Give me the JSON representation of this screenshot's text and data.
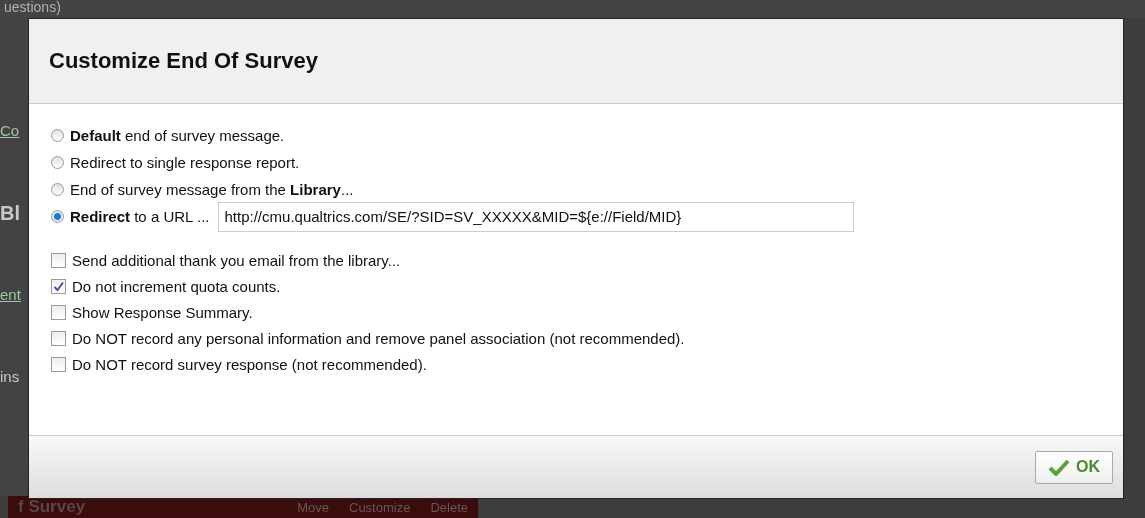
{
  "background": {
    "top_text": "uestions)",
    "side_items": [
      {
        "kind": "link",
        "text": "Co"
      },
      {
        "kind": "heading",
        "text": "Bl"
      },
      {
        "kind": "link",
        "text": "ent"
      },
      {
        "kind": "text",
        "text": "ins"
      }
    ],
    "bottom_bar": {
      "title": "f Survey",
      "actions": [
        "Move",
        "Customize",
        "Delete"
      ]
    }
  },
  "dialog": {
    "title": "Customize End Of Survey",
    "end_options": [
      {
        "label": "**Default** end of survey message.",
        "selected": false
      },
      {
        "label": "Redirect to single response report.",
        "selected": false
      },
      {
        "label": "End of survey message from the **Library**...",
        "selected": false
      },
      {
        "label": "**Redirect** to a URL ...",
        "selected": true,
        "url": "http://cmu.qualtrics.com/SE/?SID=SV_XXXXX&MID=${e://Field/MID}"
      }
    ],
    "options": [
      {
        "label": "Send additional thank you email from the library...",
        "checked": false
      },
      {
        "label": "Do not increment quota counts.",
        "checked": true
      },
      {
        "label": "Show Response Summary.",
        "checked": false
      },
      {
        "label": "Do NOT record any personal information and remove panel association (not recommended).",
        "checked": false
      },
      {
        "label": "Do NOT record survey response (not recommended).",
        "checked": false
      }
    ],
    "ok_button": "OK"
  }
}
